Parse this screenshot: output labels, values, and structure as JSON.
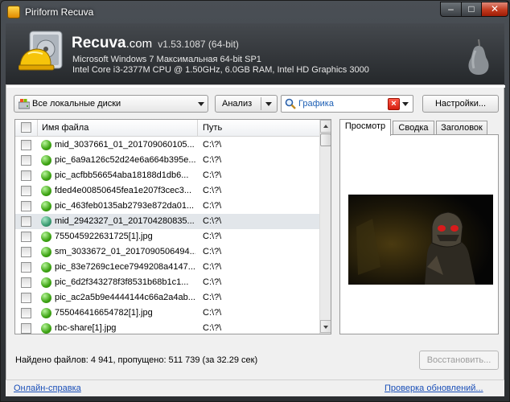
{
  "window": {
    "title": "Piriform Recuva"
  },
  "header": {
    "brand": "Recuva",
    "brand_suffix": ".com",
    "version": "v1.53.1087 (64-bit)",
    "os_line": "Microsoft Windows 7 Максимальная 64-bit SP1",
    "hw_line": "Intel Core i3-2377M CPU @ 1.50GHz, 6.0GB RAM, Intel HD Graphics 3000"
  },
  "toolbar": {
    "drive_value": "Все локальные диски",
    "scan_label": "Анализ",
    "filter_value": "Графика",
    "settings_label": "Настройки..."
  },
  "list": {
    "col_name": "Имя файла",
    "col_path": "Путь",
    "rows": [
      {
        "name": "mid_3037661_01_201709060105...",
        "path": "C:\\?\\",
        "state": "ok"
      },
      {
        "name": "pic_6a9a126c52d24e6a664b395e...",
        "path": "C:\\?\\",
        "state": "ok"
      },
      {
        "name": "pic_acfbb56654aba18188d1db6...",
        "path": "C:\\?\\",
        "state": "ok"
      },
      {
        "name": "fded4e00850645fea1e207f3cec3...",
        "path": "C:\\?\\",
        "state": "ok"
      },
      {
        "name": "pic_463feb0135ab2793e872da01...",
        "path": "C:\\?\\",
        "state": "ok"
      },
      {
        "name": "mid_2942327_01_201704280835...",
        "path": "C:\\?\\",
        "state": "teal",
        "selected": true
      },
      {
        "name": "755045922631725[1].jpg",
        "path": "C:\\?\\",
        "state": "ok"
      },
      {
        "name": "sm_3033672_01_2017090506494...",
        "path": "C:\\?\\",
        "state": "ok"
      },
      {
        "name": "pic_83e7269c1ece7949208a4147...",
        "path": "C:\\?\\",
        "state": "ok"
      },
      {
        "name": "pic_6d2f343278f3f8531b68b1c1...",
        "path": "C:\\?\\",
        "state": "ok"
      },
      {
        "name": "pic_ac2a5b9e4444144c66a2a4ab...",
        "path": "C:\\?\\",
        "state": "ok"
      },
      {
        "name": "755046416654782[1].jpg",
        "path": "C:\\?\\",
        "state": "ok"
      },
      {
        "name": "rbc-share[1].jpg",
        "path": "C:\\?\\",
        "state": "ok"
      }
    ]
  },
  "tabs": [
    {
      "label": "Просмотр",
      "active": true
    },
    {
      "label": "Сводка",
      "active": false
    },
    {
      "label": "Заголовок",
      "active": false
    }
  ],
  "status": "Найдено файлов: 4 941, пропущено: 511 739 (за 32.29 сек)",
  "recover_label": "Восстановить...",
  "footer": {
    "help_link": "Онлайн-справка",
    "update_link": "Проверка обновлений..."
  }
}
